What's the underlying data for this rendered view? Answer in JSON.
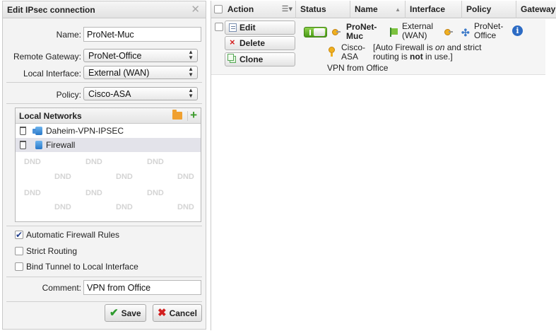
{
  "dialog": {
    "title": "Edit IPsec connection",
    "fields": {
      "name_label": "Name:",
      "name_value": "ProNet-Muc",
      "remote_gateway_label": "Remote Gateway:",
      "remote_gateway_value": "ProNet-Office",
      "local_interface_label": "Local Interface:",
      "local_interface_value": "External (WAN)",
      "policy_label": "Policy:",
      "policy_value": "Cisco-ASA",
      "comment_label": "Comment:",
      "comment_value": "VPN from Office"
    },
    "local_networks": {
      "title": "Local Networks",
      "items": [
        {
          "name": "Daheim-VPN-IPSEC"
        },
        {
          "name": "Firewall"
        }
      ],
      "dnd_label": "DND"
    },
    "options": {
      "auto_firewall": {
        "label": "Automatic Firewall Rules",
        "checked": true
      },
      "strict_routing": {
        "label": "Strict Routing",
        "checked": false
      },
      "bind_tunnel": {
        "label": "Bind Tunnel to Local Interface",
        "checked": false
      }
    },
    "buttons": {
      "save": "Save",
      "cancel": "Cancel"
    }
  },
  "grid": {
    "columns": {
      "action": "Action",
      "status": "Status",
      "name": "Name",
      "interface": "Interface",
      "policy": "Policy",
      "gateway": "Gateway"
    },
    "row": {
      "buttons": {
        "edit": "Edit",
        "delete": "Delete",
        "clone": "Clone"
      },
      "name_line1": "ProNet-",
      "name_line2": "Muc",
      "interface_line1": "External",
      "interface_line2": "(WAN)",
      "gateway_line1": "ProNet-",
      "gateway_line2": "Office",
      "policy_line1": "Cisco-",
      "policy_line2": "ASA",
      "note_pre": "[Auto Firewall is ",
      "note_on": "on",
      "note_mid": " and strict",
      "note_line2_pre": "routing is ",
      "note_not": "not",
      "note_post": " in use.]",
      "comment": "VPN from Office"
    }
  },
  "colors": {
    "accent_blue": "#2c6bc4",
    "toggle_green": "#4a9a18",
    "delete_red": "#d21e1e"
  }
}
